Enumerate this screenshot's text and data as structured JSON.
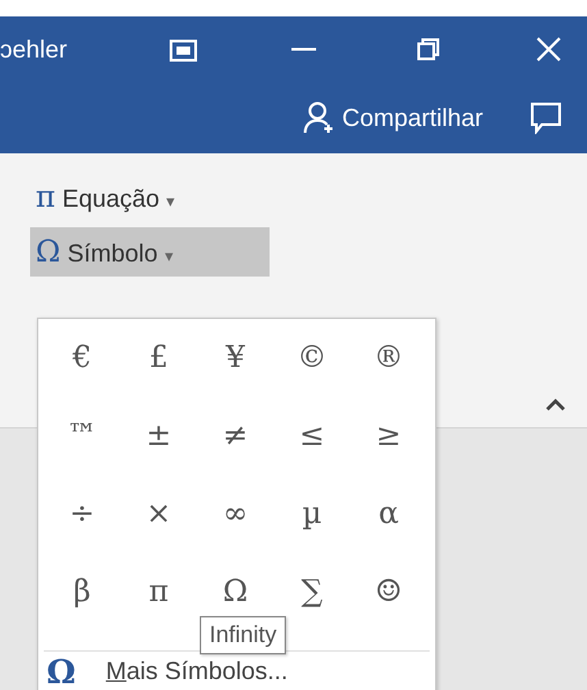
{
  "title_bar": {
    "title": "ɔehler"
  },
  "share": {
    "label": "Compartilhar"
  },
  "ribbon": {
    "items": [
      {
        "icon": "π",
        "label": "Equação",
        "caret": "▾",
        "selected": false
      },
      {
        "icon": "Ω",
        "label": "Símbolo",
        "caret": "▾",
        "selected": true
      }
    ]
  },
  "symbols": [
    "€",
    "£",
    "¥",
    "©",
    "®",
    "™",
    "±",
    "≠",
    "≤",
    "≥",
    "÷",
    "×",
    "∞",
    "µ",
    "α",
    "β",
    "π",
    "Ω",
    "∑",
    "☺"
  ],
  "tooltip": "Infinity",
  "more": {
    "icon": "Ω",
    "label": "Mais Símbolos..."
  }
}
